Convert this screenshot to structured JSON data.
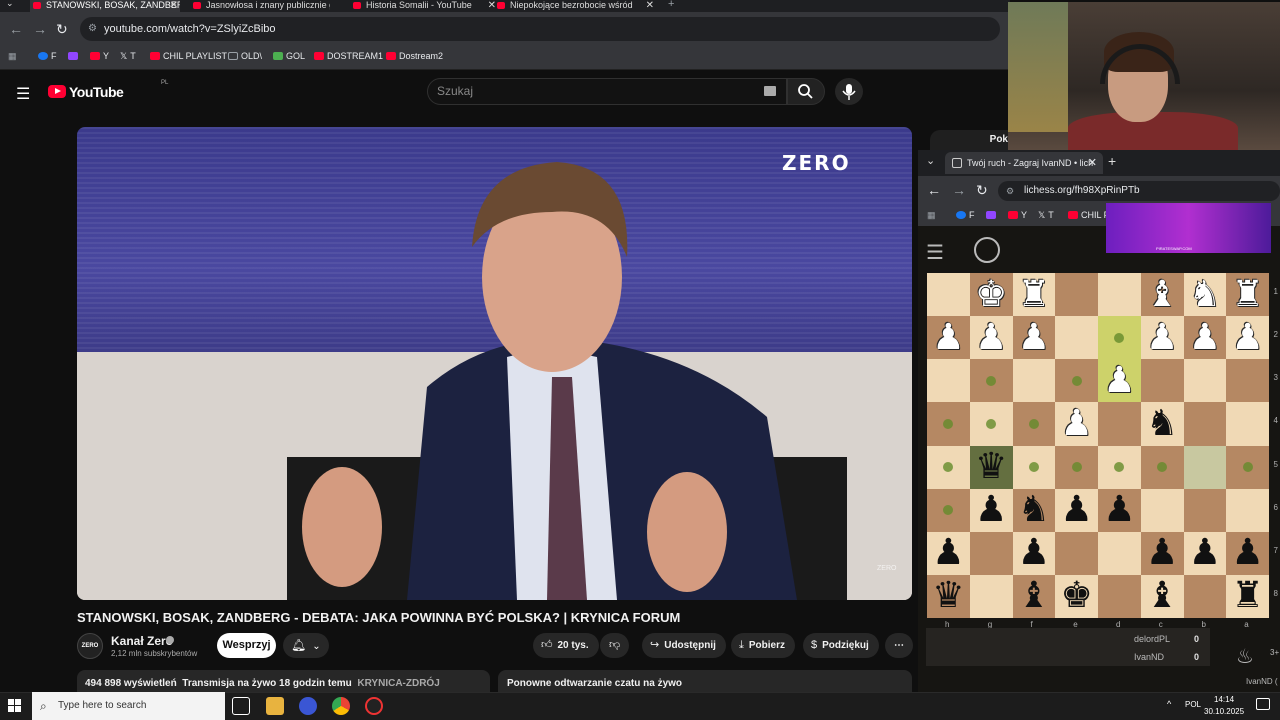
{
  "browser": {
    "tabs": [
      {
        "label": "STANOWSKI, BOSAK, ZANDBER",
        "active": true
      },
      {
        "label": "Jasnowłosa i znany publicznie g",
        "active": false
      },
      {
        "label": "Historia Somalii - YouTube",
        "active": false
      },
      {
        "label": "Niepokojące bezrobocie wśród",
        "active": false
      }
    ],
    "url": "youtube.com/watch?v=ZSlyiZcBibo",
    "bookmarks": [
      {
        "label": "F",
        "icon": "facebook-icon",
        "color": "#1877f2"
      },
      {
        "label": "",
        "icon": "twitch-icon",
        "color": "#9146ff"
      },
      {
        "label": "Y",
        "icon": "youtube-icon",
        "color": "#ff0033"
      },
      {
        "label": "T",
        "icon": "x-icon",
        "color": "#ffffff"
      },
      {
        "label": "CHIL PLAYLIST",
        "icon": "youtube-icon",
        "color": "#ff0033"
      },
      {
        "label": "OLD\\",
        "icon": "folder-icon",
        "color": "#9aa0a6"
      },
      {
        "label": "GOL",
        "icon": "gol-icon",
        "color": "#4caf50"
      },
      {
        "label": "DOSTREAM1",
        "icon": "youtube-icon",
        "color": "#ff0033"
      },
      {
        "label": "Dostream2",
        "icon": "youtube-icon",
        "color": "#ff0033"
      }
    ]
  },
  "youtube": {
    "logo_text": "YouTube",
    "country": "PL",
    "search_placeholder": "Szukaj",
    "video_overlay_logo": "ZERO",
    "video_watermark": "ZERO",
    "title": "STANOWSKI, BOSAK, ZANDBERG - DEBATA: JAKA POWINNA BYĆ POLSKA? | KRYNICA FORUM",
    "channel": {
      "avatar_text": "ZERO",
      "name": "Kanał Zero",
      "subscribers": "2,12 mln subskrybentów"
    },
    "support_label": "Wesprzyj",
    "actions": {
      "likes": "20 tys.",
      "share": "Udostępnij",
      "download": "Pobierz",
      "thanks": "Podziękuj"
    },
    "description": {
      "views": "494 898 wyświetleń",
      "stream_info": "Transmisja na żywo 18 godzin temu",
      "tag": "KRYNICA-ZDRÓJ"
    },
    "replay_label": "Ponowne odtwarzanie czatu na żywo",
    "side_button": "Pok"
  },
  "lichess": {
    "tab_title": "Twój ruch - Zagraj IvanND • lich",
    "url": "lichess.org/fh98XpRinPTb",
    "bookmarks": [
      {
        "label": "F",
        "icon": "facebook-icon"
      },
      {
        "label": "",
        "icon": "twitch-icon"
      },
      {
        "label": "Y",
        "icon": "youtube-icon"
      },
      {
        "label": "T",
        "icon": "x-icon"
      },
      {
        "label": "CHIL P",
        "icon": "youtube-icon"
      }
    ],
    "ad_text": "PIRATESWAP.COM",
    "files": [
      "h",
      "g",
      "f",
      "e",
      "d",
      "c",
      "b",
      "a"
    ],
    "ranks": [
      "1",
      "2",
      "3",
      "4",
      "5",
      "6",
      "7",
      "8"
    ],
    "board": [
      [
        "",
        "wK",
        "wR",
        "",
        "",
        "wB",
        "wN",
        "wR"
      ],
      [
        "wP",
        "wP",
        "wP",
        "",
        "",
        "wP",
        "wP",
        "wP"
      ],
      [
        "",
        "",
        "",
        "",
        "wP",
        "",
        "",
        ""
      ],
      [
        "",
        "",
        "",
        "wP",
        "",
        "bN",
        "",
        ""
      ],
      [
        "",
        "bQ",
        "",
        "",
        "",
        "",
        "",
        ""
      ],
      [
        "",
        "bP",
        "bN",
        "bP",
        "bP",
        "",
        "",
        ""
      ],
      [
        "bP",
        "",
        "bP",
        "",
        "",
        "bP",
        "bP",
        "bP"
      ],
      [
        "bQ",
        "",
        "bB",
        "bK",
        "",
        "bB",
        "",
        "bR"
      ]
    ],
    "move_dots": [
      [
        1,
        4
      ],
      [
        2,
        1
      ],
      [
        2,
        3
      ],
      [
        3,
        0
      ],
      [
        3,
        1
      ],
      [
        3,
        2
      ],
      [
        4,
        0
      ],
      [
        4,
        2
      ],
      [
        4,
        3
      ],
      [
        4,
        4
      ],
      [
        4,
        5
      ],
      [
        4,
        7
      ],
      [
        5,
        0
      ]
    ],
    "highlights": {
      "from": [
        1,
        4
      ],
      "to": [
        2,
        4
      ],
      "selected": [
        4,
        1
      ],
      "hover": [
        4,
        6
      ]
    },
    "players": [
      {
        "name": "delordPL",
        "score": "0"
      },
      {
        "name": "IvanND",
        "score": "0"
      }
    ],
    "side_info": "3+",
    "side_user": "IvanND ("
  },
  "taskbar": {
    "search_placeholder": "Type here to search",
    "language": "POL",
    "time": "14:14",
    "date": "30.10.2025"
  }
}
